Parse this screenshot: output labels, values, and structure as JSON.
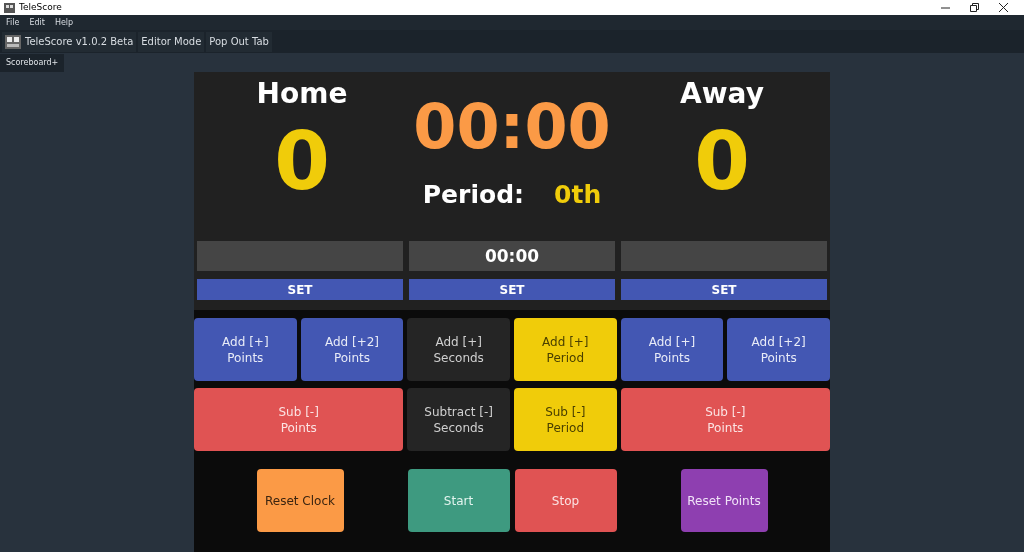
{
  "window": {
    "title": "TeleScore"
  },
  "menu": [
    "File",
    "Edit",
    "Help"
  ],
  "toolbar": [
    {
      "label": "TeleScore v1.0.2 Beta",
      "kind": "logo"
    },
    {
      "label": "Editor Mode",
      "kind": "plain"
    },
    {
      "label": "Pop Out Tab",
      "kind": "plain"
    }
  ],
  "tabs": [
    {
      "label": "Scoreboard+",
      "selected": true
    }
  ],
  "scoreboard": {
    "home": {
      "name": "Home",
      "score": "0"
    },
    "clock": "00:00",
    "period_label": "Period:",
    "period": "0th",
    "away": {
      "name": "Away",
      "score": "0"
    }
  },
  "setters": [
    {
      "button": "SET"
    },
    {
      "value": "00:00",
      "button": "SET"
    },
    {
      "button": "SET"
    }
  ],
  "button_rows": [
    [
      {
        "label": "Add [+]\nPoints",
        "kind": "blue"
      },
      {
        "label": "Add [+2]\nPoints",
        "kind": "blue"
      },
      {
        "label": "Add [+]\nSeconds",
        "kind": "dark"
      },
      {
        "label": "Add [+]\nPeriod",
        "kind": "yellow"
      },
      {
        "label": "Add [+]\nPoints",
        "kind": "blue"
      },
      {
        "label": "Add [+2]\nPoints",
        "kind": "blue"
      }
    ],
    [
      {
        "label": "Sub [-]\nPoints",
        "kind": "red"
      },
      {
        "label": "Subtract [-]\nSeconds",
        "kind": "dark"
      },
      {
        "label": "Sub [-]\nPeriod",
        "kind": "yellow"
      },
      {
        "label": "Sub [-]\nPoints",
        "kind": "red"
      }
    ]
  ],
  "bottom_buttons": [
    {
      "label": "Reset Clock",
      "kind": "orange"
    },
    {
      "label": "Start",
      "kind": "green"
    },
    {
      "label": "Stop",
      "kind": "red"
    },
    {
      "label": "Reset Points",
      "kind": "purple"
    }
  ]
}
